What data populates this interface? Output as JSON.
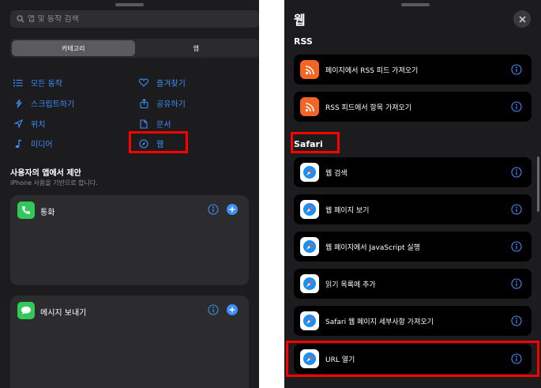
{
  "left": {
    "search_placeholder": "앱 및 동작 검색",
    "segments": [
      "카테고리",
      "앱"
    ],
    "categories": [
      {
        "label": "모든 동작",
        "icon": "list-icon"
      },
      {
        "label": "즐겨찾기",
        "icon": "heart-icon"
      },
      {
        "label": "스크립트하기",
        "icon": "script-icon"
      },
      {
        "label": "공유하기",
        "icon": "share-icon"
      },
      {
        "label": "위치",
        "icon": "location-arrow-icon"
      },
      {
        "label": "문서",
        "icon": "document-icon"
      },
      {
        "label": "미디어",
        "icon": "music-note-icon"
      },
      {
        "label": "웹",
        "icon": "compass-icon"
      }
    ],
    "suggestions_title": "사용자의 앱에서 제안",
    "suggestions_subtitle": "iPhone 사용을 기반으로 합니다.",
    "cards": [
      {
        "label": "통화",
        "icon": "phone-icon"
      },
      {
        "label": "메시지 보내기",
        "icon": "message-icon"
      }
    ]
  },
  "right": {
    "title": "웹",
    "sections": [
      {
        "title": "RSS",
        "items": [
          "페이지에서 RSS 피드 가져오기",
          "RSS 피드에서 항목 가져오기"
        ]
      },
      {
        "title": "Safari",
        "items": [
          "웹 검색",
          "웹 페이지 보기",
          "웹 페이지에서 JavaScript 실행",
          "읽기 목록에 추가",
          "Safari 웹 페이지 세부사항 가져오기",
          "URL 열기"
        ]
      }
    ]
  },
  "colors": {
    "accent": "#3e8ef7",
    "highlight": "#ff0000",
    "panel": "#1c1c1e",
    "rss": "#f26522",
    "phone_green": "#34c759"
  }
}
